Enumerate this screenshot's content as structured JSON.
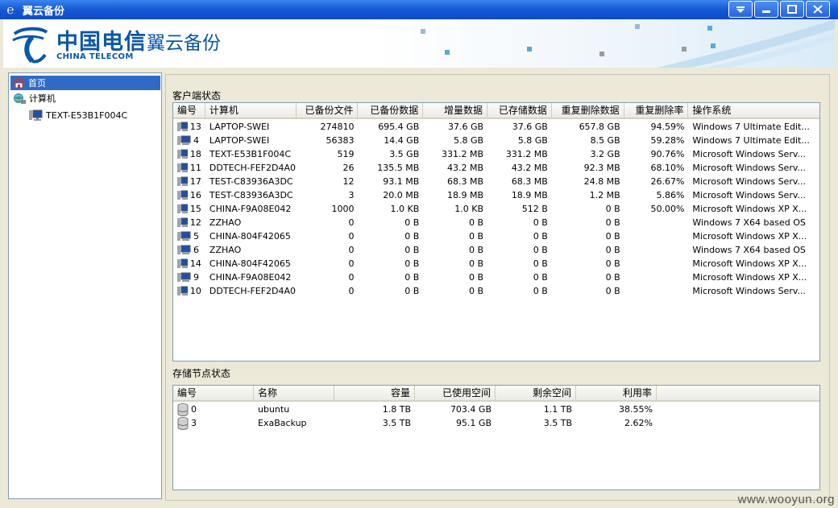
{
  "window": {
    "title": "翼云备份",
    "app_icon": "china-telecom-e-icon",
    "controls": [
      "dropdown-icon",
      "minimize-icon",
      "maximize-icon",
      "close-icon"
    ]
  },
  "banner": {
    "logo_cn": "中国电信",
    "logo_en": "CHINA TELECOM",
    "product": "翼云备份"
  },
  "tree": {
    "items": [
      {
        "label": "首页",
        "icon": "home-icon",
        "selected": true
      },
      {
        "label": "计算机",
        "icon": "network-globe-icon",
        "selected": false
      },
      {
        "label": "TEXT-E53B1F004C",
        "icon": "computer-icon",
        "selected": false
      }
    ]
  },
  "client_status": {
    "label": "客户端状态",
    "columns": [
      "编号",
      "计算机",
      "已备份文件",
      "已备份数据",
      "增量数据",
      "已存储数据",
      "重复删除数据",
      "重复删除率",
      "操作系统"
    ],
    "rows": [
      {
        "id": "13",
        "computer": "LAPTOP-SWEI",
        "files": "274810",
        "backed": "695.4 GB",
        "incr": "37.6 GB",
        "stored": "37.6 GB",
        "dedup": "657.8 GB",
        "rate": "94.59%",
        "os": "Windows 7 Ultimate Edit..."
      },
      {
        "id": "4",
        "computer": "LAPTOP-SWEI",
        "files": "56383",
        "backed": "14.4 GB",
        "incr": "5.8 GB",
        "stored": "5.8 GB",
        "dedup": "8.5 GB",
        "rate": "59.28%",
        "os": "Windows 7 Ultimate Edit..."
      },
      {
        "id": "18",
        "computer": "TEXT-E53B1F004C",
        "files": "519",
        "backed": "3.5 GB",
        "incr": "331.2 MB",
        "stored": "331.2 MB",
        "dedup": "3.2 GB",
        "rate": "90.76%",
        "os": "Microsoft Windows Serv..."
      },
      {
        "id": "11",
        "computer": "DDTECH-FEF2D4A0",
        "files": "26",
        "backed": "135.5 MB",
        "incr": "43.2 MB",
        "stored": "43.2 MB",
        "dedup": "92.3 MB",
        "rate": "68.10%",
        "os": "Microsoft Windows Serv..."
      },
      {
        "id": "17",
        "computer": "TEST-C83936A3DC",
        "files": "12",
        "backed": "93.1 MB",
        "incr": "68.3 MB",
        "stored": "68.3 MB",
        "dedup": "24.8 MB",
        "rate": "26.67%",
        "os": "Microsoft Windows Serv..."
      },
      {
        "id": "16",
        "computer": "TEST-C83936A3DC",
        "files": "3",
        "backed": "20.0 MB",
        "incr": "18.9 MB",
        "stored": "18.9 MB",
        "dedup": "1.2 MB",
        "rate": "5.86%",
        "os": "Microsoft Windows Serv..."
      },
      {
        "id": "15",
        "computer": "CHINA-F9A08E042",
        "files": "1000",
        "backed": "1.0 KB",
        "incr": "1.0 KB",
        "stored": "512 B",
        "dedup": "0 B",
        "rate": "50.00%",
        "os": "Microsoft Windows XP X..."
      },
      {
        "id": "12",
        "computer": "ZZHAO",
        "files": "0",
        "backed": "0 B",
        "incr": "0 B",
        "stored": "0 B",
        "dedup": "0 B",
        "rate": "",
        "os": "Windows 7 X64 based OS"
      },
      {
        "id": "5",
        "computer": "CHINA-804F42065",
        "files": "0",
        "backed": "0 B",
        "incr": "0 B",
        "stored": "0 B",
        "dedup": "0 B",
        "rate": "",
        "os": "Microsoft Windows XP X..."
      },
      {
        "id": "6",
        "computer": "ZZHAO",
        "files": "0",
        "backed": "0 B",
        "incr": "0 B",
        "stored": "0 B",
        "dedup": "0 B",
        "rate": "",
        "os": "Windows 7 X64 based OS"
      },
      {
        "id": "14",
        "computer": "CHINA-804F42065",
        "files": "0",
        "backed": "0 B",
        "incr": "0 B",
        "stored": "0 B",
        "dedup": "0 B",
        "rate": "",
        "os": "Microsoft Windows XP X..."
      },
      {
        "id": "9",
        "computer": "CHINA-F9A08E042",
        "files": "0",
        "backed": "0 B",
        "incr": "0 B",
        "stored": "0 B",
        "dedup": "0 B",
        "rate": "",
        "os": "Microsoft Windows XP X..."
      },
      {
        "id": "10",
        "computer": "DDTECH-FEF2D4A0",
        "files": "0",
        "backed": "0 B",
        "incr": "0 B",
        "stored": "0 B",
        "dedup": "0 B",
        "rate": "",
        "os": "Microsoft Windows Serv..."
      }
    ]
  },
  "storage_status": {
    "label": "存储节点状态",
    "columns": [
      "编号",
      "名称",
      "容量",
      "已使用空间",
      "剩余空间",
      "利用率"
    ],
    "rows": [
      {
        "id": "0",
        "name": "ubuntu",
        "capacity": "1.8 TB",
        "used": "703.4 GB",
        "free": "1.1 TB",
        "usage": "38.55%"
      },
      {
        "id": "3",
        "name": "ExaBackup",
        "capacity": "3.5 TB",
        "used": "95.1 GB",
        "free": "3.5 TB",
        "usage": "2.62%"
      }
    ]
  },
  "watermark": "www.wooyun.org",
  "colors": {
    "titlebar": "#1558d5",
    "brand": "#0b57a8",
    "selection": "#316ac5"
  }
}
